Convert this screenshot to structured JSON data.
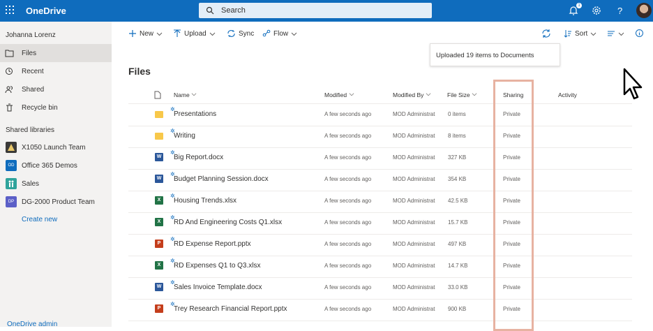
{
  "app": {
    "title": "OneDrive",
    "notification_count": "1"
  },
  "search": {
    "placeholder": "Search"
  },
  "sidebar": {
    "user": "Johanna Lorenz",
    "items": [
      {
        "label": "Files",
        "icon": "folder-icon",
        "active": true
      },
      {
        "label": "Recent",
        "icon": "clock-icon"
      },
      {
        "label": "Shared",
        "icon": "people-icon"
      },
      {
        "label": "Recycle bin",
        "icon": "trash-icon"
      }
    ],
    "shared_libraries_label": "Shared libraries",
    "libraries": [
      {
        "label": "X1050 Launch Team",
        "color": "#3b3a39",
        "abbr": ""
      },
      {
        "label": "Office 365 Demos",
        "color": "#0f6cbd",
        "abbr": "OD"
      },
      {
        "label": "Sales",
        "color": "#2fa39b",
        "abbr": ""
      },
      {
        "label": "DG-2000 Product Team",
        "color": "#5b5fc7",
        "abbr": "DP"
      }
    ],
    "create_new": "Create new",
    "admin_link": "OneDrive admin"
  },
  "commands": {
    "new": "New",
    "upload": "Upload",
    "sync": "Sync",
    "flow": "Flow",
    "sort": "Sort"
  },
  "toast": {
    "message": "Uploaded 19 items to Documents"
  },
  "page_title": "Files",
  "columns": {
    "name": "Name",
    "modified": "Modified",
    "modified_by": "Modified By",
    "file_size": "File Size",
    "sharing": "Sharing",
    "activity": "Activity"
  },
  "files": [
    {
      "name": "Presentations",
      "type": "folder",
      "modified": "A few seconds ago",
      "modified_by": "MOD Administrat",
      "size": "0 items",
      "sharing": "Private"
    },
    {
      "name": "Writing",
      "type": "folder",
      "modified": "A few seconds ago",
      "modified_by": "MOD Administrat",
      "size": "8 items",
      "sharing": "Private"
    },
    {
      "name": "Big Report.docx",
      "type": "word",
      "modified": "A few seconds ago",
      "modified_by": "MOD Administrat",
      "size": "327 KB",
      "sharing": "Private"
    },
    {
      "name": "Budget Planning Session.docx",
      "type": "word",
      "modified": "A few seconds ago",
      "modified_by": "MOD Administrat",
      "size": "354 KB",
      "sharing": "Private"
    },
    {
      "name": "Housing Trends.xlsx",
      "type": "excel",
      "modified": "A few seconds ago",
      "modified_by": "MOD Administrat",
      "size": "42.5 KB",
      "sharing": "Private"
    },
    {
      "name": "RD And Engineering Costs Q1.xlsx",
      "type": "excel",
      "modified": "A few seconds ago",
      "modified_by": "MOD Administrat",
      "size": "15.7 KB",
      "sharing": "Private"
    },
    {
      "name": "RD Expense Report.pptx",
      "type": "powerpoint",
      "modified": "A few seconds ago",
      "modified_by": "MOD Administrat",
      "size": "497 KB",
      "sharing": "Private"
    },
    {
      "name": "RD Expenses Q1 to Q3.xlsx",
      "type": "excel",
      "modified": "A few seconds ago",
      "modified_by": "MOD Administrat",
      "size": "14.7 KB",
      "sharing": "Private"
    },
    {
      "name": "Sales Invoice Template.docx",
      "type": "word",
      "modified": "A few seconds ago",
      "modified_by": "MOD Administrat",
      "size": "33.0 KB",
      "sharing": "Private"
    },
    {
      "name": "Trey Research Financial Report.pptx",
      "type": "powerpoint",
      "modified": "A few seconds ago",
      "modified_by": "MOD Administrat",
      "size": "900 KB",
      "sharing": "Private"
    }
  ],
  "colors": {
    "brand": "#0f6cbd",
    "folder": "#f8c84a",
    "word": "#2b579a",
    "excel": "#217346",
    "powerpoint": "#c43e1c",
    "highlight": "#e7b2a1"
  }
}
